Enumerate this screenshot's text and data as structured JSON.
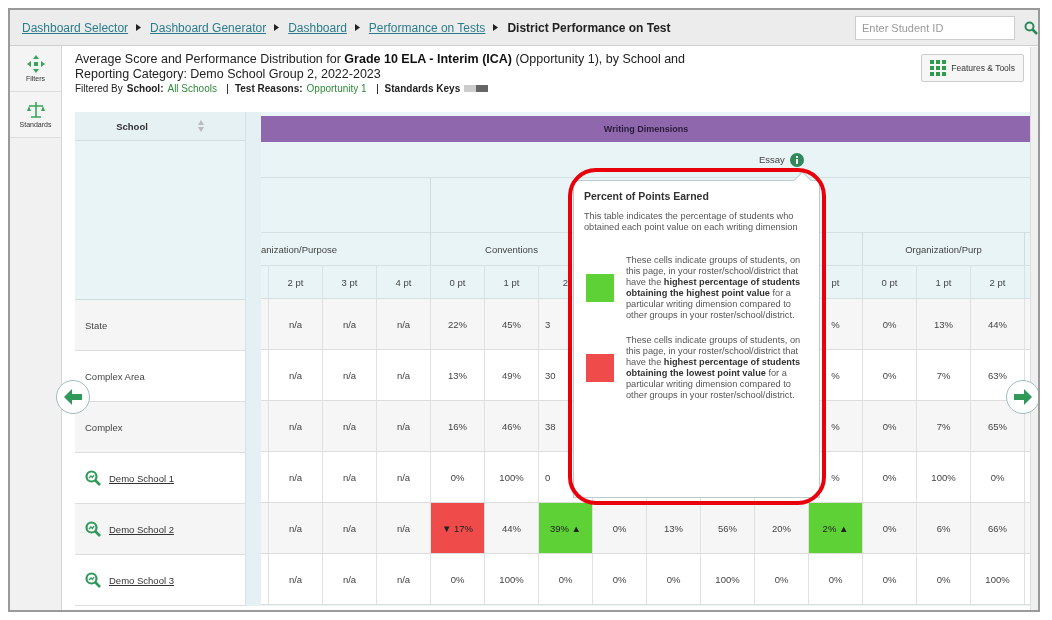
{
  "breadcrumbs": {
    "links": [
      "Dashboard Selector",
      "Dashboard Generator",
      "Dashboard",
      "Performance on Tests"
    ],
    "current": "District Performance on Test"
  },
  "student_search": {
    "placeholder": "Enter Student ID"
  },
  "sidebar": {
    "items": [
      {
        "label": "Filters",
        "kind": "filters"
      },
      {
        "label": "Standards",
        "kind": "standards"
      }
    ]
  },
  "report": {
    "title": "Average Score and Performance Distribution for **Grade 10 ELA - Interim (ICA)** (Opportunity 1), by School and Reporting Category: Demo School Group 2, 2022-2023",
    "filtered_by": "Filtered By",
    "filters": [
      {
        "label": "School:",
        "value": "All Schools"
      },
      {
        "label": "Test Reasons:",
        "value": "Opportunity 1"
      },
      {
        "label": "Standards Keys",
        "kind": "toggle"
      }
    ],
    "tools_button": "Features & Tools"
  },
  "table": {
    "school_header": "School",
    "section": "Writing Dimensions",
    "subsection": "Essay",
    "groups": [
      {
        "label": "anization/Purpose",
        "columns": [
          "2 pt",
          "3 pt",
          "4 pt"
        ]
      },
      {
        "label": "Conventions",
        "columns": [
          "0 pt",
          "1 pt",
          "2"
        ]
      },
      {
        "columns": [
          null,
          null,
          null,
          null,
          "pt"
        ]
      },
      {
        "label": "Organization/Purp",
        "columns": [
          "0 pt",
          "1 pt",
          "2 pt"
        ]
      }
    ],
    "rows": [
      {
        "name": "State",
        "link": false,
        "cells": [
          "n/a",
          "n/a",
          "n/a",
          "22%",
          "45%",
          "3",
          null,
          null,
          null,
          null,
          "%",
          "0%",
          "13%",
          "44%"
        ]
      },
      {
        "name": "Complex Area",
        "link": false,
        "cells": [
          "n/a",
          "n/a",
          "n/a",
          "13%",
          "49%",
          "30",
          null,
          null,
          null,
          null,
          "%",
          "0%",
          "7%",
          "63%"
        ]
      },
      {
        "name": "Complex",
        "link": false,
        "cells": [
          "n/a",
          "n/a",
          "n/a",
          "16%",
          "46%",
          "38",
          null,
          null,
          null,
          null,
          "%",
          "0%",
          "7%",
          "65%"
        ]
      },
      {
        "name": "Demo School 1",
        "link": true,
        "cells": [
          "n/a",
          "n/a",
          "n/a",
          "0%",
          "100%",
          "0",
          null,
          null,
          null,
          null,
          "%",
          "0%",
          "100%",
          "0%"
        ]
      },
      {
        "name": "Demo School 2",
        "link": true,
        "cells": [
          "n/a",
          "n/a",
          "n/a",
          {
            "text": "▼ 17%",
            "color": "#ef4b4b"
          },
          "44%",
          {
            "text": "39% ▲",
            "color": "#5ed136"
          },
          "0%",
          "13%",
          "56%",
          "20%",
          {
            "text": "2% ▲",
            "color": "#5ed136"
          },
          "0%",
          "6%",
          "66%"
        ]
      },
      {
        "name": "Demo School 3",
        "link": true,
        "cells": [
          "n/a",
          "n/a",
          "n/a",
          "0%",
          "100%",
          "0%",
          "0%",
          "0%",
          "100%",
          "0%",
          "0%",
          "0%",
          "0%",
          "100%"
        ]
      }
    ]
  },
  "tooltip": {
    "title": "Percent of Points Earned",
    "description": "This table indicates the percentage of students who obtained each point value on each writing dimension",
    "legend": [
      {
        "color": "#5ed136",
        "text": "These cells indicate groups of students, on this page, in your roster/school/district that have the **highest percentage of students obtaining the highest point value** for a particular writing dimension compared to other groups in your roster/school/district."
      },
      {
        "color": "#ef4b4b",
        "text": "These cells indicate groups of students, on this page, in your roster/school/district that have the **highest percentage of students obtaining the lowest point value** for a particular writing dimension compared to other groups in your roster/school/district."
      }
    ]
  }
}
